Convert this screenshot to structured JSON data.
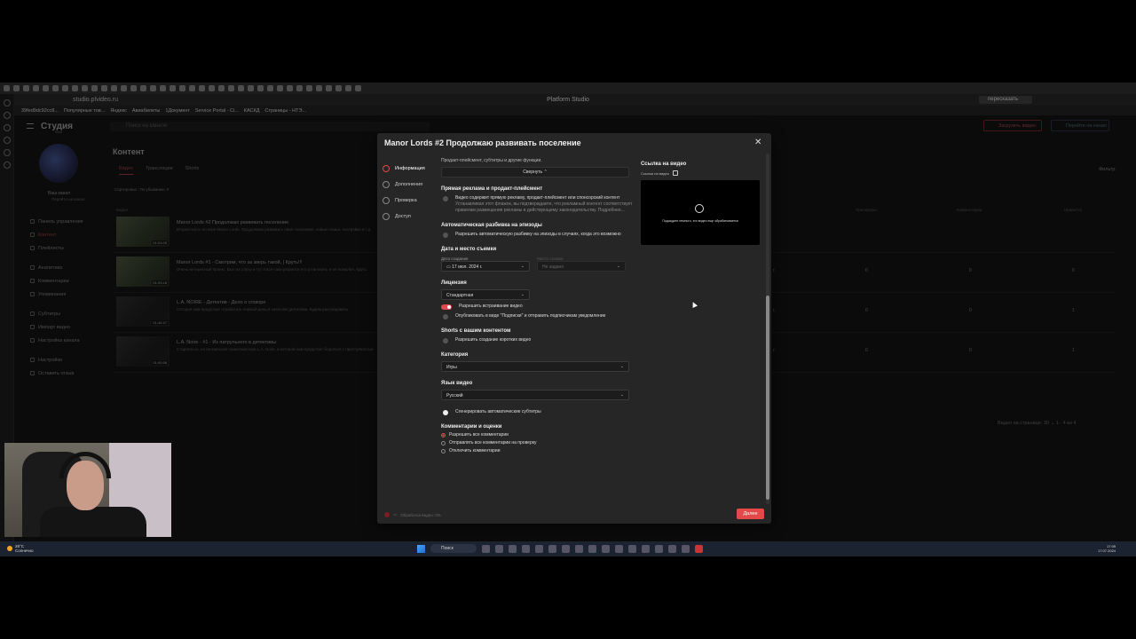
{
  "browser": {
    "url": "studio.plvideo.ru",
    "window_title": "Platform Studio",
    "extension_label": "пересказать",
    "bookmarks": [
      "39fed9dc92cc8...",
      "Популярные тов...",
      "Яндекс",
      "Авиабилеты",
      "1Документ",
      "Service Portal - Ci...",
      "КАСКД",
      "Страницы - НТЭ..."
    ]
  },
  "app": {
    "logo": "Студия",
    "logo_sub": "beta",
    "search_placeholder": "Поиск на канале",
    "upload_label": "Загрузить видео",
    "go_label": "Перейти на канал",
    "channel_name": "Ваш канал",
    "channel_link": "Перейти на канал",
    "nav": [
      {
        "label": "Панель управления"
      },
      {
        "label": "Контент",
        "active": true
      },
      {
        "label": "Плейлисты"
      },
      {
        "label": "Аналитика"
      },
      {
        "label": "Комментарии"
      },
      {
        "label": "Упоминания"
      },
      {
        "label": "Субтитры"
      },
      {
        "label": "Импорт видео"
      },
      {
        "label": "Настройка канала"
      },
      {
        "label": "Настройки"
      },
      {
        "label": "Оставить отзыв"
      }
    ],
    "content_title": "Контент",
    "tabs": [
      "Видео",
      "Трансляции",
      "Shorts"
    ],
    "sort_label": "Сортировка : По убыванию",
    "filter_label": "Фильтр",
    "columns": [
      "Видео",
      "Просмотры",
      "Комментарии",
      "Нравится"
    ],
    "videos": [
      {
        "title": "Manor Lords #2 Продолжаю развивать поселение",
        "desc": "Вторая часть по игре Manor Lords. Продолжаю развивать своё поселение, новые семьи, постройки и т.д.",
        "duration": "01:01:09",
        "date": "",
        "views": "",
        "comments": "",
        "likes": ""
      },
      {
        "title": "Manor Lords #1 - Смотрим, что за зверь такой, | Круть!!!",
        "desc": "Очень интересный проект. Был на слуху и тут я всё-таки решился его установить и не пожалел. Круть",
        "duration": "01:03:18",
        "date": "г.",
        "views": "0",
        "comments": "0",
        "likes": "0"
      },
      {
        "title": "L.A. NOIRE - Детектив - Дело о сговоре",
        "desc": "Сегодня нам предстоит отработать первый день в качестве детектива. Будем расследовать",
        "duration": "01:42:47",
        "date": "г.",
        "views": "0",
        "comments": "0",
        "likes": "1"
      },
      {
        "title": "L.A. Noire - #1 - Из патрульного в детективы",
        "desc": "Стартельно, но интересная сюжетная игра L.A. Noire, в которой нам предстоит бороться с преступностью",
        "duration": "01:00:58",
        "date": "г.",
        "views": "0",
        "comments": "0",
        "likes": "1"
      }
    ],
    "pager": "Видео на странице:  30  ⌄     1 - 4 из 4"
  },
  "modal": {
    "title": "Manor Lords #2 Продолжаю развивать поселение",
    "steps": [
      "Информация",
      "Дополнения",
      "Проверка",
      "Доступ"
    ],
    "intro_note": "Продакт-плейсмент, субтитры и другие функции.",
    "collapse_label": "Свернуть",
    "ads_title": "Прямая реклама и продакт-плейсмент",
    "ads_check": "Видео содержит прямую рекламу, продакт-плейсмент или спонсорский контент",
    "ads_sub": "Устанавливая этот флажок, вы подтверждаете, что рекламный контент соответствует правилам размещения рекламы и действующему законодательству. Подробнее...",
    "episodes_title": "Автоматическая разбивка на эпизоды",
    "episodes_check": "Разрешить автоматическую разбивку на эпизоды в случаях, когда это возможно",
    "date_title": "Дата и место съемки",
    "date_label": "Дата создания",
    "place_label": "Место съемки",
    "date_value": "17 июл. 2024 г.",
    "place_value": "Не задано",
    "license_title": "Лицензия",
    "license_value": "Стандартная",
    "embed_label": "Разрешить встраивание видео",
    "subs_feed_label": "Опубликовать в виде \"Подписки\" и отправить подписчикам уведомление",
    "shorts_title": "Shorts с вашим контентом",
    "shorts_check": "Разрешить создание коротких видео",
    "category_title": "Категория",
    "category_value": "Игры",
    "lang_title": "Язык видео",
    "lang_value": "Русский",
    "autosubs_label": "Сгенерировать автоматические субтитры",
    "comments_title": "Комментарии и оценки",
    "comment_options": [
      "Разрешить все комментарии",
      "Отправлять все комментарии на проверку",
      "Отключить комментарии"
    ],
    "preview_label": "Ссылка на видео",
    "preview_sub": "Ссылка на видео",
    "preview_text": "Подождите немного, это видео еще обрабатывается",
    "footer_status": "Обработка видео: 0%",
    "next_label": "Далее"
  },
  "taskbar": {
    "temp": "26°C",
    "weather": "Солнечно",
    "search": "Поиск",
    "time": "17:09",
    "date": "17.07.2024"
  },
  "colors": {
    "accent": "#e54848",
    "background": "#151515",
    "modal": "#262626"
  }
}
